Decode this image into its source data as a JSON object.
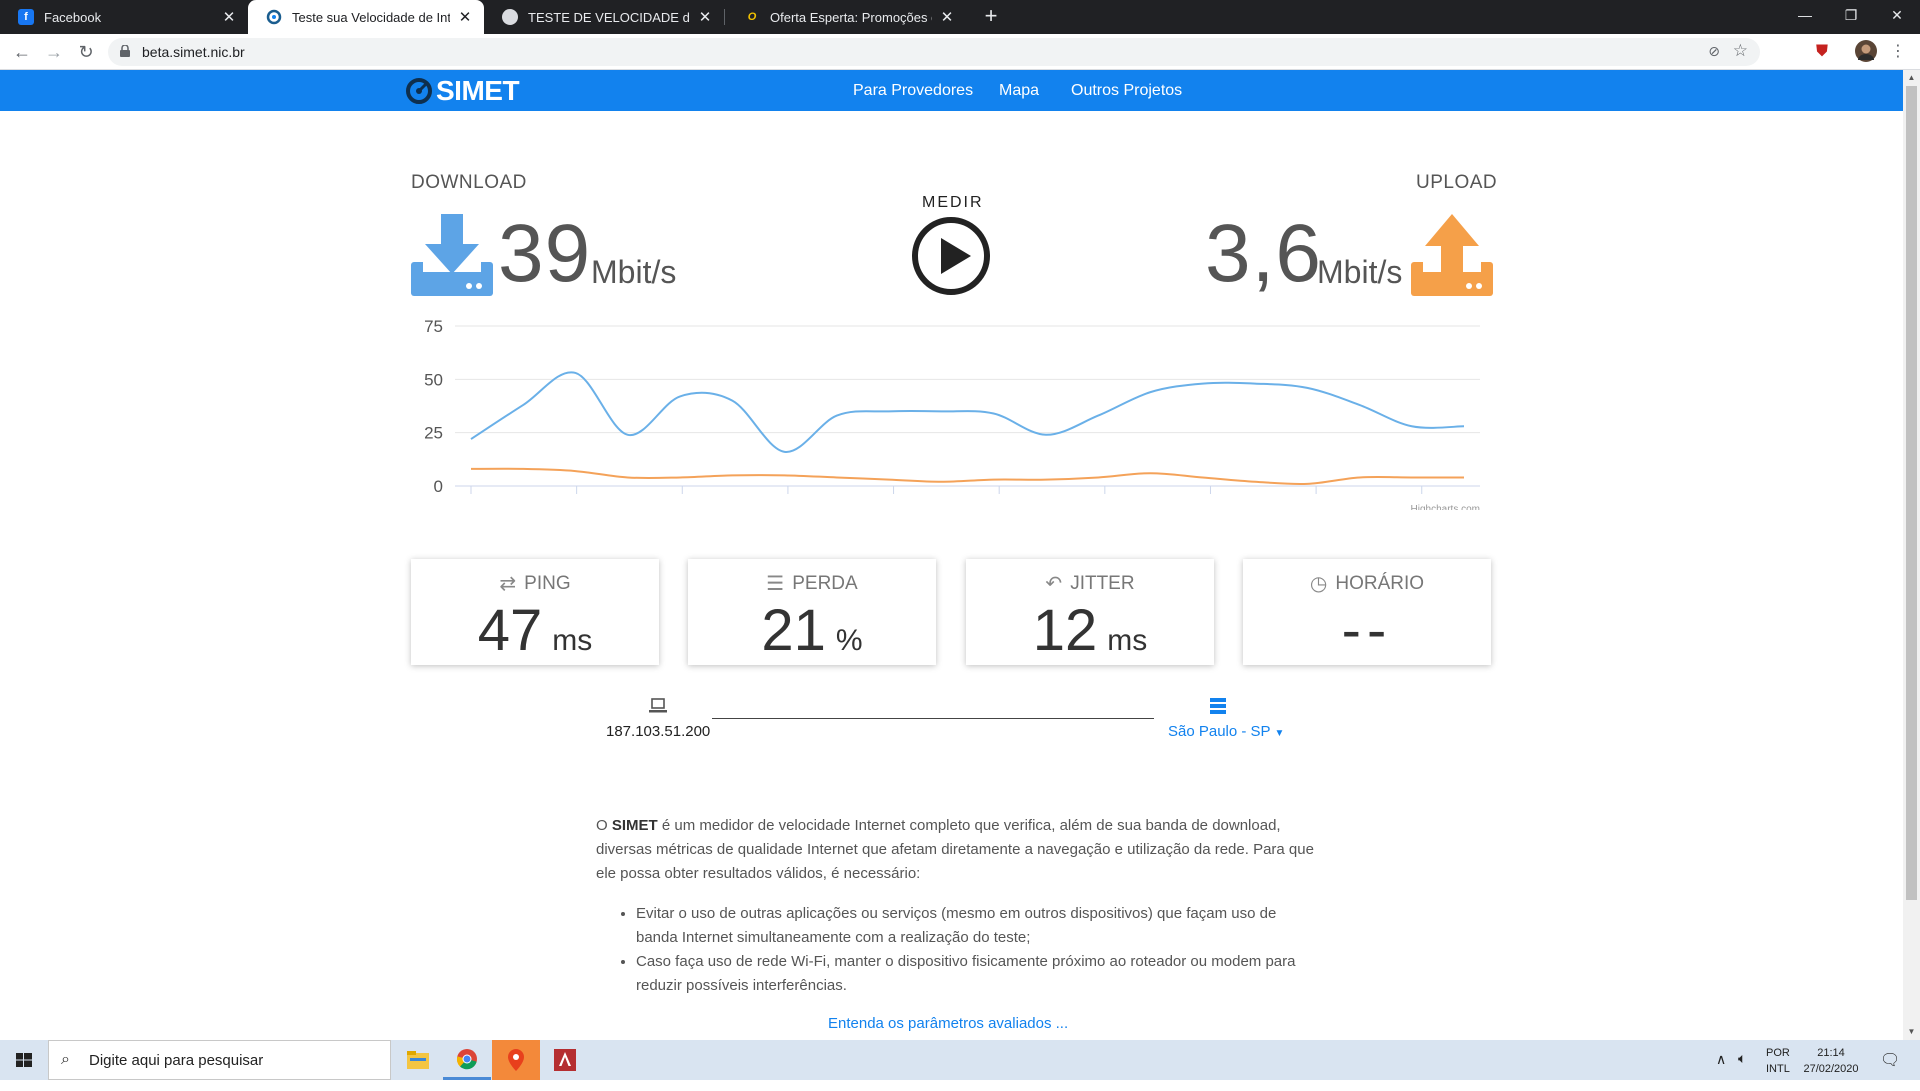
{
  "browser": {
    "tabs": [
      {
        "title": "Facebook",
        "active": false
      },
      {
        "title": "Teste sua Velocidade de Internet",
        "active": true
      },
      {
        "title": "TESTE DE VELOCIDADE da Internet",
        "active": false
      },
      {
        "title": "Oferta Esperta: Promoções de Ve",
        "active": false
      }
    ],
    "url": "beta.simet.nic.br"
  },
  "site": {
    "logo": "SIMET",
    "nav": [
      "Para Provedores",
      "Mapa",
      "Outros Projetos"
    ]
  },
  "speed": {
    "download_label": "DOWNLOAD",
    "download_value": "39",
    "download_unit": "Mbit/s",
    "upload_label": "UPLOAD",
    "upload_value": "3,6",
    "upload_unit": "Mbit/s",
    "medir_label": "MEDIR",
    "download_color": "#5da4e6",
    "upload_color": "#f5a049"
  },
  "chart_data": {
    "type": "line",
    "ylim": [
      0,
      75
    ],
    "yticks": [
      "75",
      "50",
      "25",
      "0"
    ],
    "credit": "Highcharts.com",
    "x": [
      0,
      1,
      2,
      3,
      4,
      5,
      6,
      7,
      8,
      9,
      10,
      11,
      12,
      13,
      14,
      15,
      16,
      17,
      18,
      19
    ],
    "series": [
      {
        "color": "#6ab0e8",
        "values": [
          22,
          38,
          53,
          24,
          42,
          40,
          16,
          33,
          35,
          35,
          34,
          24,
          33,
          44,
          48,
          48,
          46,
          38,
          28,
          28
        ]
      },
      {
        "color": "#f4a259",
        "values": [
          8,
          8,
          7,
          4,
          4,
          5,
          5,
          4,
          3,
          2,
          3,
          3,
          4,
          6,
          4,
          2,
          1,
          4,
          4,
          4
        ]
      }
    ]
  },
  "metrics": [
    {
      "label": "PING",
      "value": "47",
      "unit": "ms",
      "icon": "retweet-icon"
    },
    {
      "label": "PERDA",
      "value": "21",
      "unit": "%",
      "icon": "list-check-icon"
    },
    {
      "label": "JITTER",
      "value": "12",
      "unit": "ms",
      "icon": "reply-all-icon"
    },
    {
      "label": "HORÁRIO",
      "value": "--",
      "unit": "",
      "icon": "clock-icon"
    }
  ],
  "connection": {
    "client_ip": "187.103.51.200",
    "server": "São Paulo - SP"
  },
  "description": {
    "intro_brand": "SIMET",
    "intro_prefix": "O",
    "intro_text": "é um medidor de velocidade Internet completo que verifica, além de sua banda de download, diversas métricas de qualidade Internet que afetam diretamente a navegação e utilização da rede. Para que ele possa obter resultados válidos, é necessário:",
    "items": [
      "Evitar o uso de outras aplicações ou serviços (mesmo em outros dispositivos) que façam uso de banda Internet simultaneamente com a realização do teste;",
      "Caso faça uso de rede Wi-Fi, manter o dispositivo fisicamente próximo ao roteador ou modem para reduzir possíveis interferências."
    ],
    "link": "Entenda os parâmetros avaliados ..."
  },
  "taskbar": {
    "search_placeholder": "Digite aqui para pesquisar",
    "lang_top": "POR",
    "lang_bottom": "INTL",
    "time": "21:14",
    "date": "27/02/2020"
  }
}
